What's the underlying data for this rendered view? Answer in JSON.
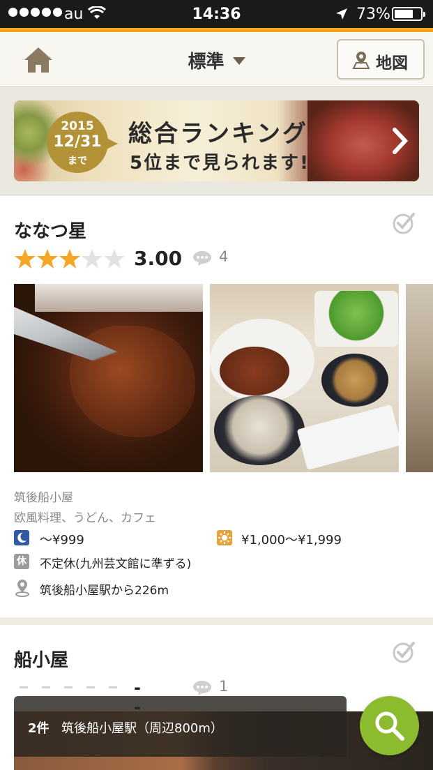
{
  "status_bar": {
    "carrier": "au",
    "time": "14:36",
    "battery": "73%",
    "battery_level_fraction": 0.73,
    "signal_dots": 5
  },
  "nav": {
    "title": "標準",
    "map_button_label": "地図"
  },
  "banner": {
    "year": "2015",
    "date": "12/31",
    "until": "まで",
    "line1": "総合ランキング",
    "line2": "5位まで見られます!"
  },
  "restaurants": [
    {
      "name": "ななつ星",
      "rating_value": 3.0,
      "rating_text": "3.00",
      "review_count": "4",
      "area": "筑後船小屋",
      "genres": "欧風料理、うどん、カフェ",
      "dinner_price": "〜¥999",
      "lunch_price": "¥1,000〜¥1,999",
      "holiday": "不定休(九州芸文館に準ずる)",
      "access": "筑後船小屋駅から226m",
      "holiday_badge": "休"
    },
    {
      "name": "船小屋",
      "rating_text": "---",
      "review_count": "1"
    }
  ],
  "bottom_bar": {
    "count": "2件",
    "area": "筑後船小屋駅（周辺800m）"
  },
  "colors": {
    "accent_orange": "#f3a61b",
    "star_gold": "#f5a623",
    "search_green": "#8dbb2f",
    "moon_blue": "#2f5aa5",
    "sun_orange": "#e8a23b"
  },
  "icons": {
    "home": "home-icon",
    "map_pin": "map-pin-icon",
    "check": "check-circle-icon",
    "comment": "comment-bubble-icon",
    "moon": "moon-icon",
    "sun": "sun-icon",
    "location": "location-pin-icon",
    "search": "search-icon"
  }
}
